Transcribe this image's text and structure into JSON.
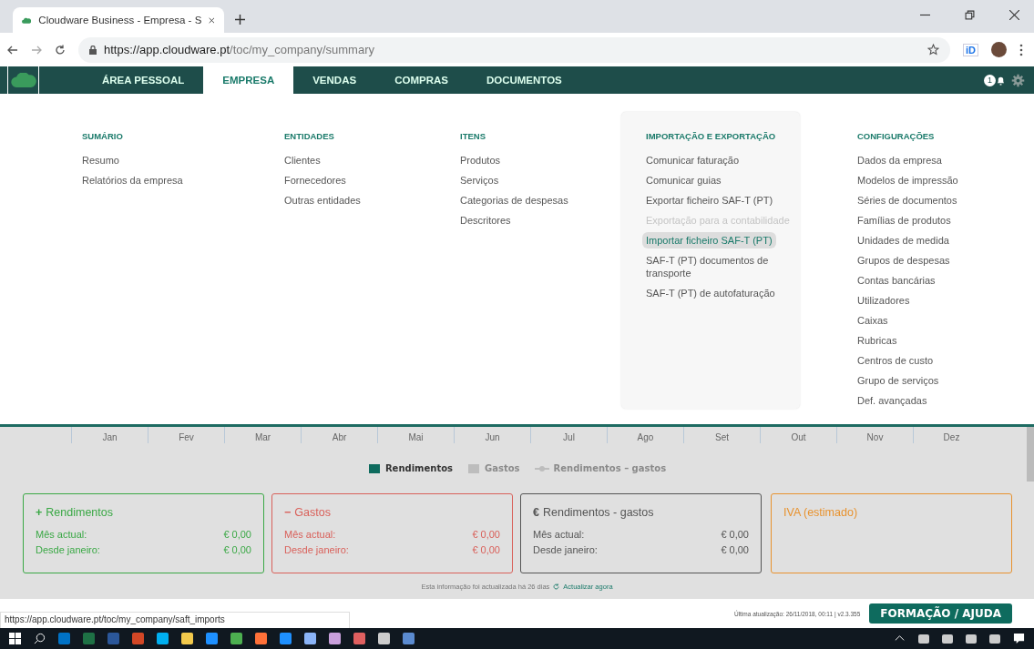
{
  "browser": {
    "tab_title": "Cloudware Business - Empresa - S",
    "url_host": "https://app.cloudware.pt",
    "url_path": "/toc/my_company/summary",
    "extension_label": "iD"
  },
  "nav": {
    "items": [
      {
        "label": "ÁREA PESSOAL",
        "selected": false
      },
      {
        "label": "EMPRESA",
        "selected": true
      },
      {
        "label": "VENDAS",
        "selected": false
      },
      {
        "label": "COMPRAS",
        "selected": false
      },
      {
        "label": "DOCUMENTOS",
        "selected": false
      }
    ],
    "notification_count": "1"
  },
  "menu": {
    "columns": [
      {
        "heading": "SUMÁRIO",
        "panel": false,
        "items": [
          {
            "label": "Resumo",
            "selected": false,
            "disabled": false
          },
          {
            "label": "Relatórios da empresa",
            "selected": false,
            "disabled": false
          }
        ]
      },
      {
        "heading": "ENTIDADES",
        "panel": false,
        "items": [
          {
            "label": "Clientes",
            "selected": false,
            "disabled": false
          },
          {
            "label": "Fornecedores",
            "selected": false,
            "disabled": false
          },
          {
            "label": "Outras entidades",
            "selected": false,
            "disabled": false
          }
        ]
      },
      {
        "heading": "ITENS",
        "panel": false,
        "items": [
          {
            "label": "Produtos",
            "selected": false,
            "disabled": false
          },
          {
            "label": "Serviços",
            "selected": false,
            "disabled": false
          },
          {
            "label": "Categorias de despesas",
            "selected": false,
            "disabled": false
          },
          {
            "label": "Descritores",
            "selected": false,
            "disabled": false
          }
        ]
      },
      {
        "heading": "IMPORTAÇÃO E EXPORTAÇÃO",
        "panel": true,
        "items": [
          {
            "label": "Comunicar faturação",
            "selected": false,
            "disabled": false
          },
          {
            "label": "Comunicar guias",
            "selected": false,
            "disabled": false
          },
          {
            "label": "Exportar ficheiro SAF-T (PT)",
            "selected": false,
            "disabled": false
          },
          {
            "label": "Exportação para a contabilidade",
            "selected": false,
            "disabled": true
          },
          {
            "label": "Importar ficheiro SAF-T (PT)",
            "selected": true,
            "disabled": false
          },
          {
            "label": "SAF-T (PT) documentos de transporte",
            "selected": false,
            "disabled": false
          },
          {
            "label": "SAF-T (PT) de autofaturação",
            "selected": false,
            "disabled": false
          }
        ]
      },
      {
        "heading": "CONFIGURAÇÕES",
        "panel": false,
        "items": [
          {
            "label": "Dados da empresa",
            "selected": false,
            "disabled": false
          },
          {
            "label": "Modelos de impressão",
            "selected": false,
            "disabled": false
          },
          {
            "label": "Séries de documentos",
            "selected": false,
            "disabled": false
          },
          {
            "label": "Famílias de produtos",
            "selected": false,
            "disabled": false
          },
          {
            "label": "Unidades de medida",
            "selected": false,
            "disabled": false
          },
          {
            "label": "Grupos de despesas",
            "selected": false,
            "disabled": false
          },
          {
            "label": "Contas bancárias",
            "selected": false,
            "disabled": false
          },
          {
            "label": "Utilizadores",
            "selected": false,
            "disabled": false
          },
          {
            "label": "Caixas",
            "selected": false,
            "disabled": false
          },
          {
            "label": "Rubricas",
            "selected": false,
            "disabled": false
          },
          {
            "label": "Centros de custo",
            "selected": false,
            "disabled": false
          },
          {
            "label": "Grupo de serviços",
            "selected": false,
            "disabled": false
          },
          {
            "label": "Def. avançadas",
            "selected": false,
            "disabled": false
          }
        ]
      }
    ]
  },
  "chart": {
    "months": [
      "Jan",
      "Fev",
      "Mar",
      "Abr",
      "Mai",
      "Jun",
      "Jul",
      "Ago",
      "Set",
      "Out",
      "Nov",
      "Dez"
    ],
    "legend": [
      {
        "label": "Rendimentos",
        "kind": "box",
        "on": true,
        "color": "#0e6b5e"
      },
      {
        "label": "Gastos",
        "kind": "box",
        "on": false,
        "color": "#bdbdbd"
      },
      {
        "label": "Rendimentos – gastos",
        "kind": "line",
        "on": false,
        "color": "#bdbdbd"
      }
    ]
  },
  "cards": [
    {
      "title": "Rendimentos",
      "symbol": "+",
      "color": "#3aa845",
      "rows": [
        {
          "label": "Mês actual:",
          "value": "€ 0,00"
        },
        {
          "label": "Desde janeiro:",
          "value": "€ 0,00"
        }
      ]
    },
    {
      "title": "Gastos",
      "symbol": "−",
      "color": "#d9605a",
      "rows": [
        {
          "label": "Mês actual:",
          "value": "€ 0,00"
        },
        {
          "label": "Desde janeiro:",
          "value": "€ 0,00"
        }
      ]
    },
    {
      "title": "Rendimentos - gastos",
      "symbol": "€",
      "color": "#555555",
      "rows": [
        {
          "label": "Mês actual:",
          "value": "€ 0,00"
        },
        {
          "label": "Desde janeiro:",
          "value": "€ 0,00"
        }
      ]
    },
    {
      "title": "IVA (estimado)",
      "color": "#e8922e"
    }
  ],
  "info": {
    "text": "Esta informação foi actualizada há 26 dias",
    "link": "Actualizar agora"
  },
  "footer": {
    "status_url": "https://app.cloudware.pt/toc/my_company/saft_imports",
    "update_text": "Última atualização: 26/11/2018, 00:11 | v2.3.355",
    "help_button": "FORMAÇÃO / AJUDA"
  }
}
